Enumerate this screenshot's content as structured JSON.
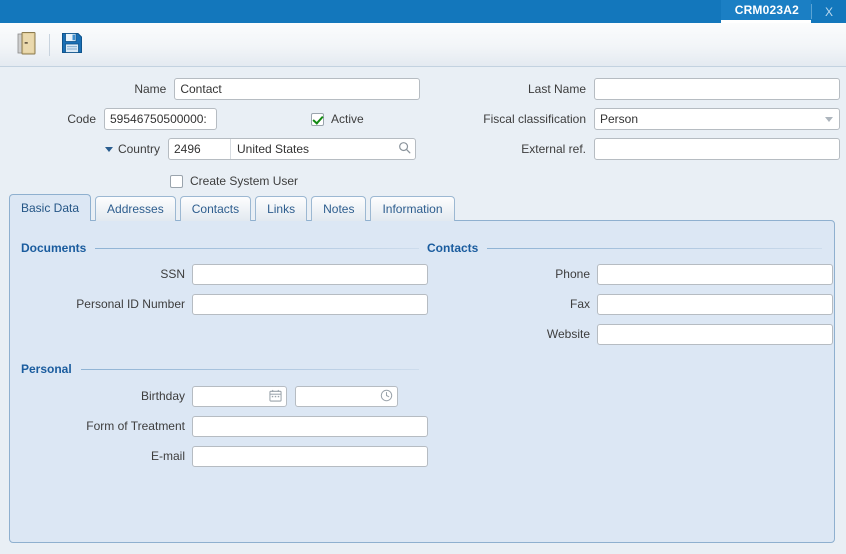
{
  "titlebar": {
    "tab_label": "CRM023A2",
    "close_label": "X"
  },
  "toolbar": {
    "exit_icon": "door-exit-icon",
    "save_icon": "floppy-save-icon"
  },
  "top_form": {
    "name": {
      "label": "Name",
      "value": "Contact"
    },
    "code": {
      "label": "Code",
      "value": "59546750500000:"
    },
    "active": {
      "label": "Active",
      "checked": true
    },
    "country": {
      "label": "Country",
      "code": "2496",
      "description": "United States",
      "search_icon": "search-icon"
    },
    "create_system_user": {
      "label": "Create System User",
      "checked": false
    },
    "last_name": {
      "label": "Last Name",
      "value": ""
    },
    "fiscal_classification": {
      "label": "Fiscal classification",
      "value": "Person",
      "options": [
        "Person"
      ]
    },
    "external_ref": {
      "label": "External ref.",
      "value": ""
    }
  },
  "tabs": [
    {
      "label": "Basic Data",
      "active": true
    },
    {
      "label": "Addresses",
      "active": false
    },
    {
      "label": "Contacts",
      "active": false
    },
    {
      "label": "Links",
      "active": false
    },
    {
      "label": "Notes",
      "active": false
    },
    {
      "label": "Information",
      "active": false
    }
  ],
  "basic_data": {
    "documents": {
      "title": "Documents",
      "ssn": {
        "label": "SSN",
        "value": ""
      },
      "personal_id_number": {
        "label": "Personal ID Number",
        "value": ""
      }
    },
    "contacts": {
      "title": "Contacts",
      "phone": {
        "label": "Phone",
        "value": ""
      },
      "fax": {
        "label": "Fax",
        "value": ""
      },
      "website": {
        "label": "Website",
        "value": ""
      }
    },
    "personal": {
      "title": "Personal",
      "birthday": {
        "label": "Birthday",
        "date_value": "",
        "time_value": "",
        "date_icon": "calendar-icon",
        "time_icon": "clock-icon"
      },
      "form_of_treatment": {
        "label": "Form of Treatment",
        "value": ""
      },
      "email": {
        "label": "E-mail",
        "value": ""
      }
    }
  },
  "colors": {
    "titlebar": "#1377bc",
    "panel_bg": "#dce7f4",
    "page_bg": "#e9eff5",
    "group_title": "#1a5c9e",
    "tab_text": "#2d5d8e",
    "check_green": "#128a12"
  }
}
